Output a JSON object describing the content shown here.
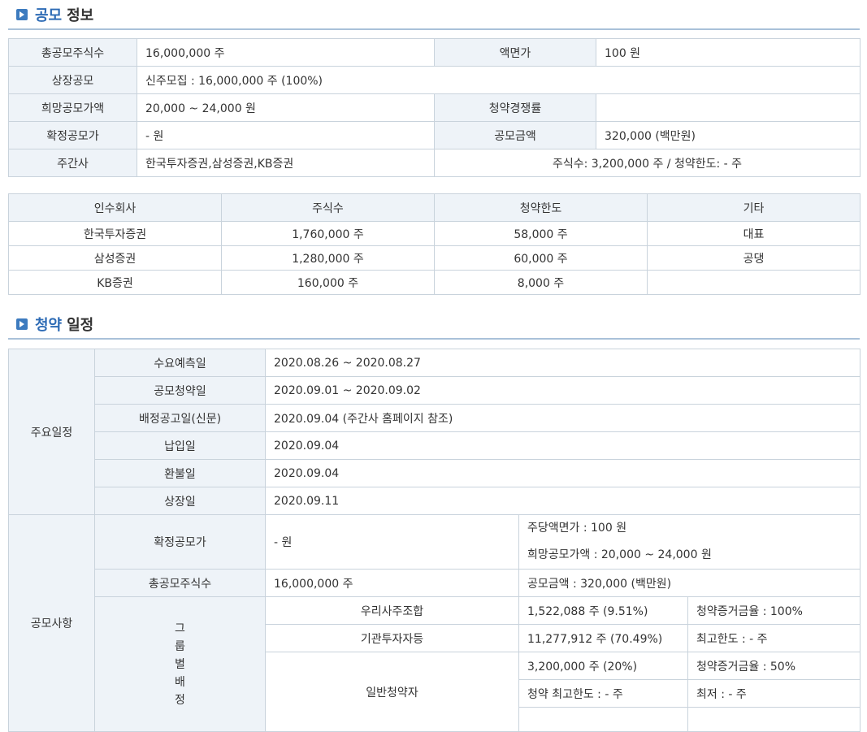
{
  "section1": {
    "title_hl": "공모",
    "title_rest": "정보"
  },
  "info": {
    "total_shares_label": "총공모주식수",
    "total_shares": "16,000,000 주",
    "par_label": "액면가",
    "par": "100 원",
    "listing_label": "상장공모",
    "listing": "신주모집 : 16,000,000 주 (100%)",
    "hope_price_label": "희망공모가액",
    "hope_price": "20,000 ~ 24,000 원",
    "competition_label": "청약경쟁률",
    "competition": "",
    "final_price_label": "확정공모가",
    "final_price": "- 원",
    "amount_label": "공모금액",
    "amount": "320,000 (백만원)",
    "manager_label": "주간사",
    "manager": "한국투자증권,삼성증권,KB증권",
    "manager_shares": "주식수: 3,200,000 주   /   청약한도: - 주"
  },
  "underwriters": {
    "headers": [
      "인수회사",
      "주식수",
      "청약한도",
      "기타"
    ],
    "rows": [
      [
        "한국투자증권",
        "1,760,000 주",
        "58,000 주",
        "대표"
      ],
      [
        "삼성증권",
        "1,280,000 주",
        "60,000 주",
        "공댕"
      ],
      [
        "KB증권",
        "160,000 주",
        "8,000 주",
        ""
      ]
    ]
  },
  "section2": {
    "title_hl": "청약",
    "title_rest": "일정"
  },
  "schedule": {
    "group_label": "주요일정",
    "items": [
      {
        "label": "수요예측일",
        "value": "2020.08.26  ~   2020.08.27"
      },
      {
        "label": "공모청약일",
        "value": "2020.09.01  ~   2020.09.02"
      },
      {
        "label": "배정공고일(신문)",
        "value": "2020.09.04 (주간사 홈페이지 참조)"
      },
      {
        "label": "납입일",
        "value": "2020.09.04"
      },
      {
        "label": "환불일",
        "value": "2020.09.04"
      },
      {
        "label": "상장일",
        "value": "2020.09.11"
      }
    ]
  },
  "offering": {
    "group_label": "공모사항",
    "final_price_label": "확정공모가",
    "final_price": "- 원",
    "par_line": "주당액면가 :  100 원",
    "hope_line": "희망공모가액 :  20,000 ~ 24,000 원",
    "total_label": "총공모주식수",
    "total": "16,000,000 주",
    "amount_line": "공모금액 : 320,000 (백만원)",
    "group_vertical": [
      "그",
      "룹",
      "별",
      "배",
      "정"
    ],
    "employee_label": "우리사주조합",
    "employee_shares": "1,522,088 주  (9.51%)",
    "employee_note": "청약증거금율 : 100%",
    "inst_label": "기관투자자등",
    "inst_shares": "11,277,912 주  (70.49%)",
    "inst_note": "최고한도 :  - 주",
    "retail_label": "일반청약자",
    "retail_shares": "3,200,000 주  (20%)",
    "retail_note": "청약증거금율 : 50%",
    "retail_max": "청약 최고한도 :  - 주",
    "retail_min": "최저 :  - 주"
  }
}
